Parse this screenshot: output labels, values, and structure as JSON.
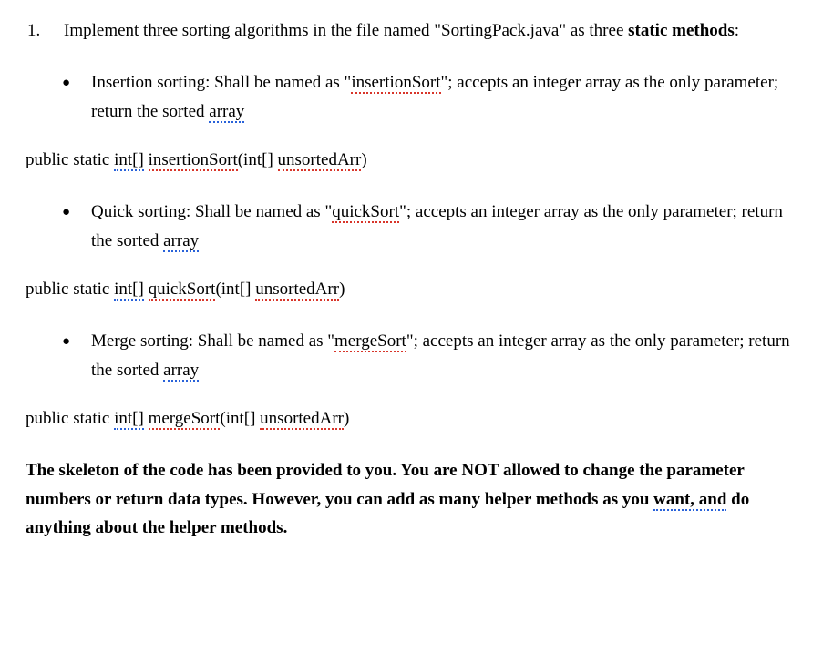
{
  "item_number": "1.",
  "intro_pre": "Implement three sorting algorithms in the file named \"SortingPack.java\" as three ",
  "intro_bold": "static methods",
  "intro_post": ":",
  "bullets": [
    {
      "label": "Insertion sorting: Shall be named as \"",
      "method": "insertionSort",
      "after_method": "\"; accepts an integer array as the only parameter; return the sorted ",
      "array_word": "array"
    },
    {
      "label": "Quick sorting: Shall be named as \"",
      "method": "quickSort",
      "after_method": "\"; accepts an integer array as the only parameter; return the sorted ",
      "array_word": "array"
    },
    {
      "label": "Merge sorting: Shall be named as \"",
      "method": "mergeSort",
      "after_method": "\"; accepts an integer array as the only parameter; return the sorted ",
      "array_word": "array"
    }
  ],
  "signatures": [
    {
      "prefix": "public static ",
      "inttype": "int[]",
      "space": " ",
      "func": "insertionSort",
      "open": "(int[] ",
      "param": "unsortedArr",
      "close": ")"
    },
    {
      "prefix": "public static ",
      "inttype": "int[]",
      "space": " ",
      "func": "quickSort",
      "open": "(int[] ",
      "param": "unsortedArr",
      "close": ")"
    },
    {
      "prefix": "public static ",
      "inttype": "int[]",
      "space": " ",
      "func": "mergeSort",
      "open": "(int[] ",
      "param": "unsortedArr",
      "close": ")"
    }
  ],
  "note": {
    "part1": "The skeleton of the code has been provided to you. You are NOT allowed to change the parameter numbers or return data types. However, you can add as many helper methods as you ",
    "want_and": "want, and",
    "part2": " do anything about the helper methods."
  }
}
